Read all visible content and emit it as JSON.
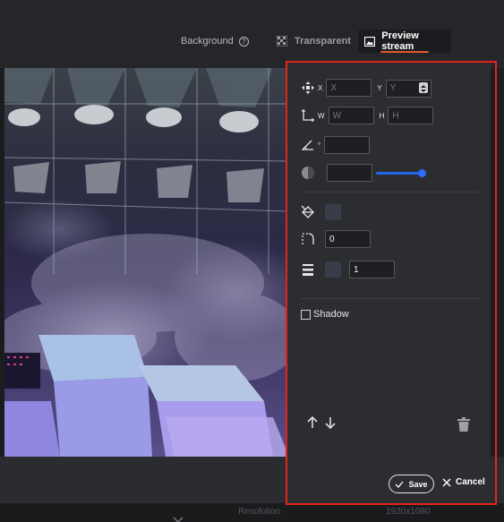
{
  "topbar": {
    "background_label": "Background",
    "help_icon_glyph": "?",
    "transparent_label": "Transparent",
    "preview_stream_label": "Preview stream"
  },
  "panel": {
    "position": {
      "x_label": "X",
      "x_placeholder": "X",
      "y_label": "Y",
      "y_placeholder": "Y"
    },
    "size": {
      "w_label": "W",
      "w_placeholder": "W",
      "h_label": "H",
      "h_placeholder": "H"
    },
    "rotation": {
      "degree_label": "°",
      "value": ""
    },
    "opacity": {
      "value": ""
    },
    "corner_radius": {
      "value": "0"
    },
    "border": {
      "width": "1"
    },
    "shadow": {
      "label": "Shadow",
      "checked": false
    },
    "save_label": "Save",
    "cancel_label": "Cancel"
  },
  "footer": {
    "resolution_label": "Resolution",
    "resolution_value": "1920x1080"
  },
  "colors": {
    "accent": "#e4572e",
    "slider": "#2563eb",
    "highlight_box": "#e0241b"
  }
}
